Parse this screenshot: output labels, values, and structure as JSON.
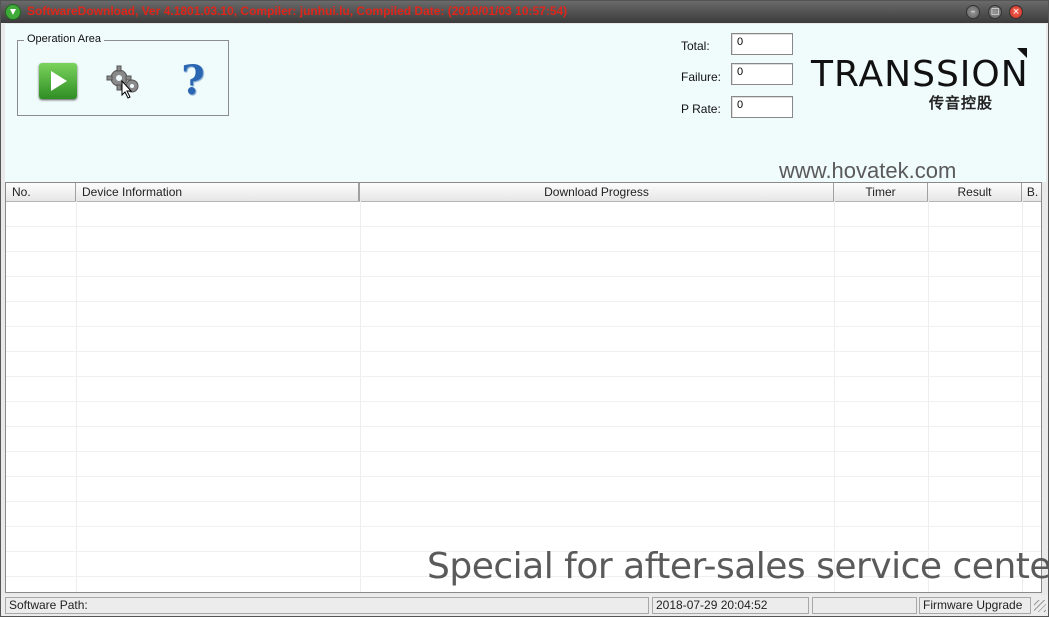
{
  "window": {
    "title": "SoftwareDownload, Ver 4.1801.03.10, Compiler: junhui.lu, Compiled Date: (2018/01/03 10:57:54)",
    "title_color": "#e0261a"
  },
  "operation_area": {
    "label": "Operation Area",
    "icons": [
      "play-icon",
      "gear-icon",
      "help-icon"
    ],
    "help_glyph": "?"
  },
  "stats": {
    "total_label": "Total:",
    "total_value": "0",
    "failure_label": "Failure:",
    "failure_value": "0",
    "prate_label": "P Rate:",
    "prate_value": "0"
  },
  "logo": {
    "text": "TRANSSION",
    "cn_text": "传音控股"
  },
  "watermark": {
    "url": "www.hovatek.com",
    "special": "Special for after-sales service centers"
  },
  "table": {
    "columns": [
      "No.",
      "Device Information",
      "Download Progress",
      "Timer",
      "Result",
      "B."
    ],
    "rows": []
  },
  "statusbar": {
    "software_path": "Software Path:",
    "datetime": "2018-07-29 20:04:52",
    "blank": "",
    "mode": "Firmware Upgrade"
  }
}
